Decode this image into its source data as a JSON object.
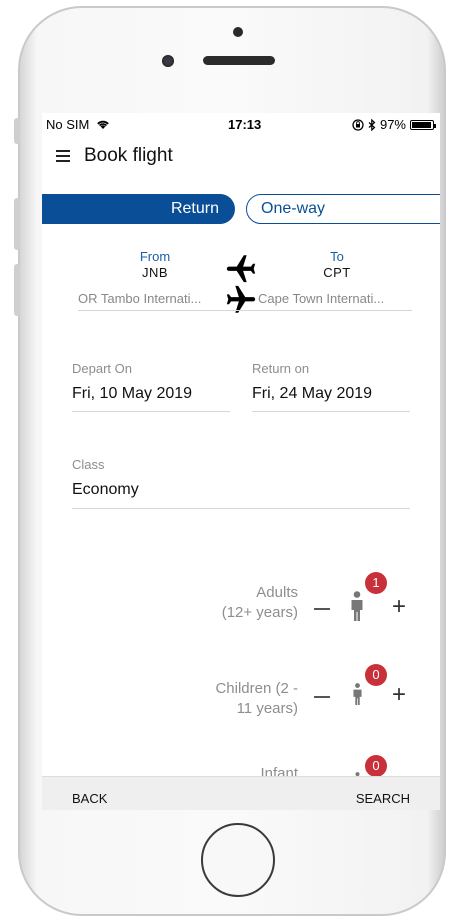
{
  "status_bar": {
    "carrier": "No SIM",
    "time": "17:13",
    "battery": "97%",
    "battery_fraction": 0.97
  },
  "header": {
    "title": "Book flight"
  },
  "trip_type": {
    "return_label": "Return",
    "oneway_label": "One-way",
    "selected": "Return"
  },
  "route": {
    "from_label": "From",
    "from_code": "JNB",
    "from_name": "OR Tambo Internati...",
    "to_label": "To",
    "to_code": "CPT",
    "to_name": "Cape Town Internati..."
  },
  "dates": {
    "depart_label": "Depart On",
    "depart_value": "Fri, 10 May 2019",
    "return_label": "Return on",
    "return_value": "Fri, 24 May 2019"
  },
  "class": {
    "label": "Class",
    "value": "Economy"
  },
  "passengers": {
    "adults_label_1": "Adults",
    "adults_label_2": "(12+ years)",
    "adults_count": "1",
    "children_label_1": "Children (2 -",
    "children_label_2": "11 years)",
    "children_count": "0",
    "infant_label": "Infant",
    "infant_count": "0"
  },
  "footer": {
    "back_label": "BACK",
    "search_label": "SEARCH"
  },
  "colors": {
    "accent": "#0b4e98",
    "link": "#1a5ea8",
    "badge": "#c8303a"
  }
}
